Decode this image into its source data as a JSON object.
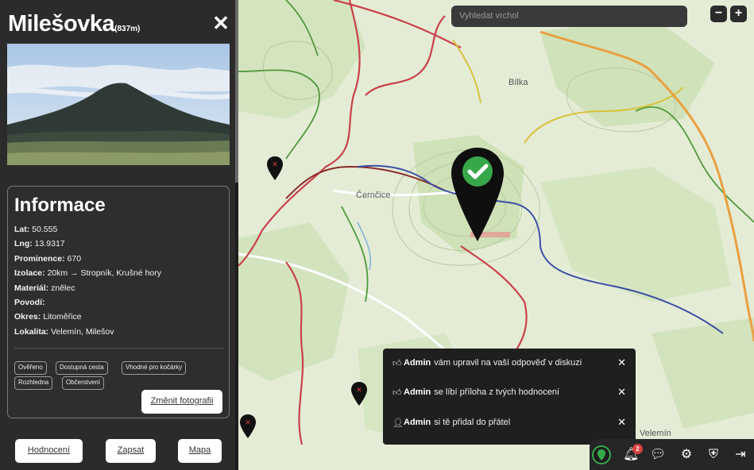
{
  "sidebar": {
    "peak_name": "Milešovka",
    "peak_elevation": "(837m)",
    "close_icon": "close-icon",
    "info": {
      "title": "Informace",
      "lines": [
        {
          "key": "Lat:",
          "val": "50.555"
        },
        {
          "key": "Lng:",
          "val": "13.9317"
        },
        {
          "key": "Prominence:",
          "val": "670"
        },
        {
          "key": "Izolace:",
          "val": "20km → Stropník, Krušné hory"
        },
        {
          "key": "Materiál:",
          "val": "znělec"
        },
        {
          "key": "Povodí:",
          "val": ""
        },
        {
          "key": "Okres:",
          "val": "Litoměřice"
        },
        {
          "key": "Lokalita:",
          "val": "Velemín, Milešov"
        }
      ],
      "tags": [
        "Ověřeno",
        "Dostupná cesta",
        "Vhodné pro kočárky",
        "Rozhledna",
        "Občerstvení"
      ],
      "add_photo_label": "Změnit fotografii"
    },
    "actions": {
      "rate_label": "Hodnocení",
      "visit_label": "Zapsat",
      "map_label": "Mapa"
    }
  },
  "map": {
    "search_placeholder": "Vyhledat vrchol",
    "zoom_out": "−",
    "zoom_in": "+",
    "labels": {
      "town1": "Černčice",
      "town2": "Bílka",
      "town3": "Velemín"
    }
  },
  "notifications": [
    {
      "user": "Admin",
      "message": "vám upravil na vaší odpověď v diskuzi",
      "icon": "thumbs-up-icon"
    },
    {
      "user": "Admin",
      "message": "se líbí příloha z tvých hodnocení",
      "icon": "thumbs-up-icon"
    },
    {
      "user": "Admin",
      "message": "si tě přidal do přátel",
      "icon": "user-icon"
    }
  ],
  "bottombar": {
    "badge_count": "2"
  },
  "colors": {
    "sidebar_bg": "#2b2b2b",
    "accent_green": "#37a84a",
    "pin": "#111111"
  }
}
